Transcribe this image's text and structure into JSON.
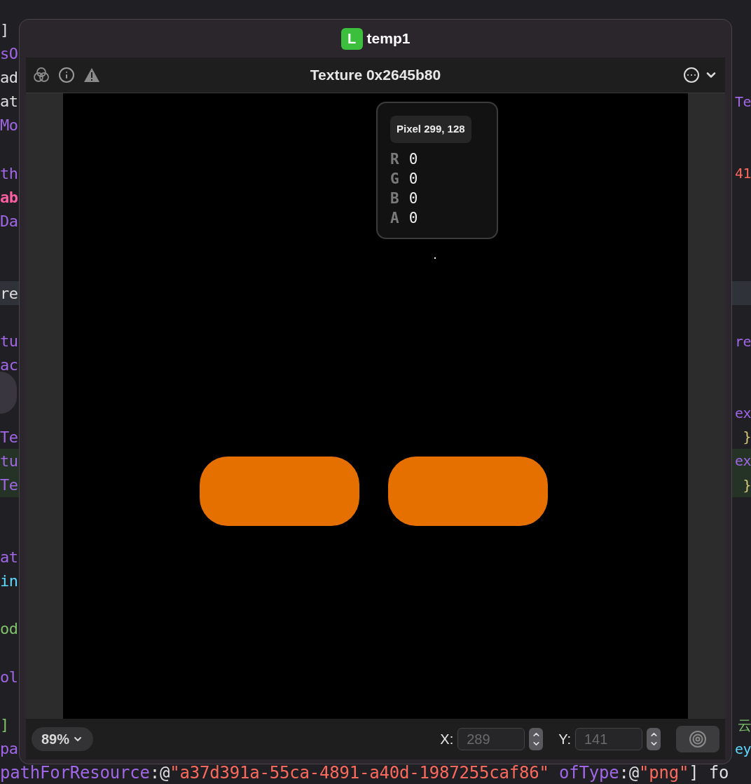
{
  "editor": {
    "lines": [
      {
        "kind": "plain",
        "left": [
          {
            "text": "]",
            "kind": "plain"
          }
        ]
      },
      {
        "kind": "plain",
        "left": [
          {
            "text": "sO",
            "kind": "type"
          }
        ]
      },
      {
        "kind": "plain",
        "left": [
          {
            "text": "ad",
            "kind": "plain"
          }
        ]
      },
      {
        "kind": "plain",
        "left": [
          {
            "text": "at",
            "kind": "plain"
          }
        ],
        "right": [
          {
            "text": "Te",
            "kind": "type"
          }
        ]
      },
      {
        "kind": "plain",
        "left": [
          {
            "text": "Mo",
            "kind": "type"
          }
        ]
      },
      {
        "kind": "plain"
      },
      {
        "kind": "plain",
        "left": [
          {
            "text": "th",
            "kind": "type"
          }
        ],
        "right": [
          {
            "text": "41",
            "kind": "number"
          }
        ]
      },
      {
        "kind": "plain",
        "left": [
          {
            "text": "ab",
            "kind": "keyword"
          }
        ]
      },
      {
        "kind": "plain",
        "left": [
          {
            "text": "Da",
            "kind": "type"
          }
        ]
      },
      {
        "kind": "plain"
      },
      {
        "kind": "plain"
      },
      {
        "kind": "current",
        "left": [
          {
            "text": "re",
            "kind": "plain"
          }
        ]
      },
      {
        "kind": "plain"
      },
      {
        "kind": "plain",
        "left": [
          {
            "text": "tu",
            "kind": "type"
          }
        ],
        "right": [
          {
            "text": "re",
            "kind": "type"
          }
        ]
      },
      {
        "kind": "plain",
        "left": [
          {
            "text": "ac",
            "kind": "type"
          }
        ]
      },
      {
        "kind": "plain"
      },
      {
        "kind": "plain",
        "right": [
          {
            "text": "ex",
            "kind": "type"
          }
        ]
      },
      {
        "kind": "plain",
        "left": [
          {
            "text": "Te",
            "kind": "type"
          }
        ],
        "right": [
          {
            "text": "}",
            "kind": "brace"
          }
        ]
      },
      {
        "kind": "added",
        "left": [
          {
            "text": "tu",
            "kind": "type"
          }
        ],
        "right": [
          {
            "text": "ex",
            "kind": "type"
          }
        ]
      },
      {
        "kind": "added",
        "left": [
          {
            "text": "Te",
            "kind": "type"
          }
        ],
        "right": [
          {
            "text": "}",
            "kind": "brace"
          }
        ]
      },
      {
        "kind": "plain"
      },
      {
        "kind": "plain"
      },
      {
        "kind": "plain",
        "left": [
          {
            "text": "at",
            "kind": "type"
          }
        ]
      },
      {
        "kind": "plain",
        "left": [
          {
            "text": "in",
            "kind": "method"
          }
        ]
      },
      {
        "kind": "plain"
      },
      {
        "kind": "plain",
        "left": [
          {
            "text": "od",
            "kind": "comment"
          }
        ]
      },
      {
        "kind": "plain"
      },
      {
        "kind": "plain",
        "left": [
          {
            "text": "ol",
            "kind": "type"
          }
        ]
      },
      {
        "kind": "plain"
      },
      {
        "kind": "plain",
        "left": [
          {
            "text": "]",
            "kind": "comment"
          }
        ],
        "right": [
          {
            "text": "云",
            "kind": "comment"
          }
        ]
      },
      {
        "kind": "plain",
        "left": [
          {
            "text": "pa",
            "kind": "type"
          }
        ],
        "right": [
          {
            "text": "ey",
            "kind": "method"
          }
        ]
      },
      {
        "kind": "plain",
        "left": [
          {
            "text": "pathForResource",
            "kind": "type"
          },
          {
            "text": ":@",
            "kind": "plain"
          },
          {
            "text": "\"a37d391a-55ca-4891-a40d-1987255caf86\"",
            "kind": "string"
          },
          {
            "text": " ofType",
            "kind": "type"
          },
          {
            "text": ":@",
            "kind": "plain"
          },
          {
            "text": "\"png\"",
            "kind": "string"
          },
          {
            "text": "] fo",
            "kind": "plain"
          }
        ]
      }
    ]
  },
  "window": {
    "badge": "L",
    "title": "temp1",
    "toolbar": {
      "title": "Texture 0x2645b80"
    },
    "pixel_inspector": {
      "title": "Pixel 299, 128",
      "channels": [
        {
          "label": "R",
          "value": "0"
        },
        {
          "label": "G",
          "value": "0"
        },
        {
          "label": "B",
          "value": "0"
        },
        {
          "label": "A",
          "value": "0"
        }
      ]
    },
    "zoom": "89%",
    "coordinates": [
      {
        "label": "X:",
        "placeholder": "289"
      },
      {
        "label": "Y:",
        "placeholder": "141"
      }
    ]
  }
}
